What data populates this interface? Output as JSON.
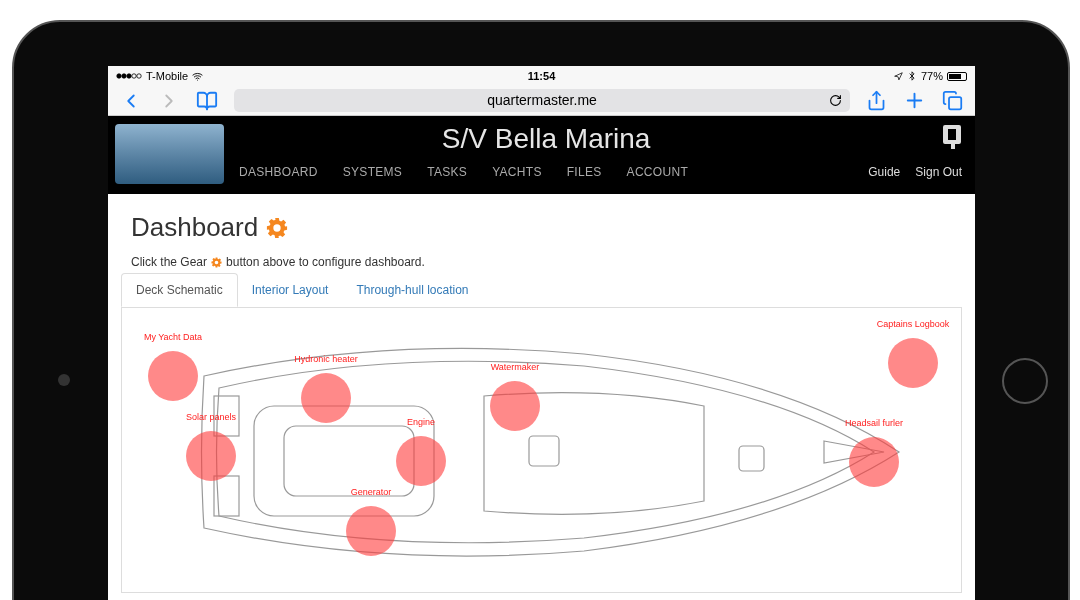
{
  "status_bar": {
    "carrier": "T-Mobile",
    "time": "11:54",
    "battery": "77%"
  },
  "browser": {
    "url": "quartermaster.me"
  },
  "site_header": {
    "title": "S/V Bella Marina",
    "nav": [
      "DASHBOARD",
      "SYSTEMS",
      "TASKS",
      "YACHTS",
      "FILES",
      "ACCOUNT"
    ],
    "links": [
      "Guide",
      "Sign Out"
    ]
  },
  "page": {
    "heading": "Dashboard",
    "hint_before": "Click the Gear",
    "hint_after": "button above to configure dashboard."
  },
  "tabs": [
    {
      "label": "Deck Schematic",
      "selected": true
    },
    {
      "label": "Interior Layout",
      "selected": false
    },
    {
      "label": "Through-hull location",
      "selected": false
    }
  ],
  "hotspots": [
    "My Yacht Data",
    "Hydronic heater",
    "Watermaker",
    "Captains Logbook",
    "Solar panels",
    "Engine",
    "Headsail furler",
    "Generator"
  ]
}
